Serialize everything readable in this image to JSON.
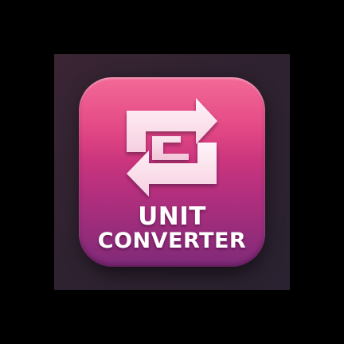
{
  "app": {
    "label_line_1": "UNIT",
    "label_line_2": "CONVERTER",
    "icon_name": "convert-arrows-icon"
  },
  "colors": {
    "page_background": "#000000",
    "backdrop": "#2f2230",
    "gradient_top": "#f0487f",
    "gradient_bottom": "#7f2a78",
    "glyph": "#fbe3ec",
    "text": "#ffffff"
  }
}
